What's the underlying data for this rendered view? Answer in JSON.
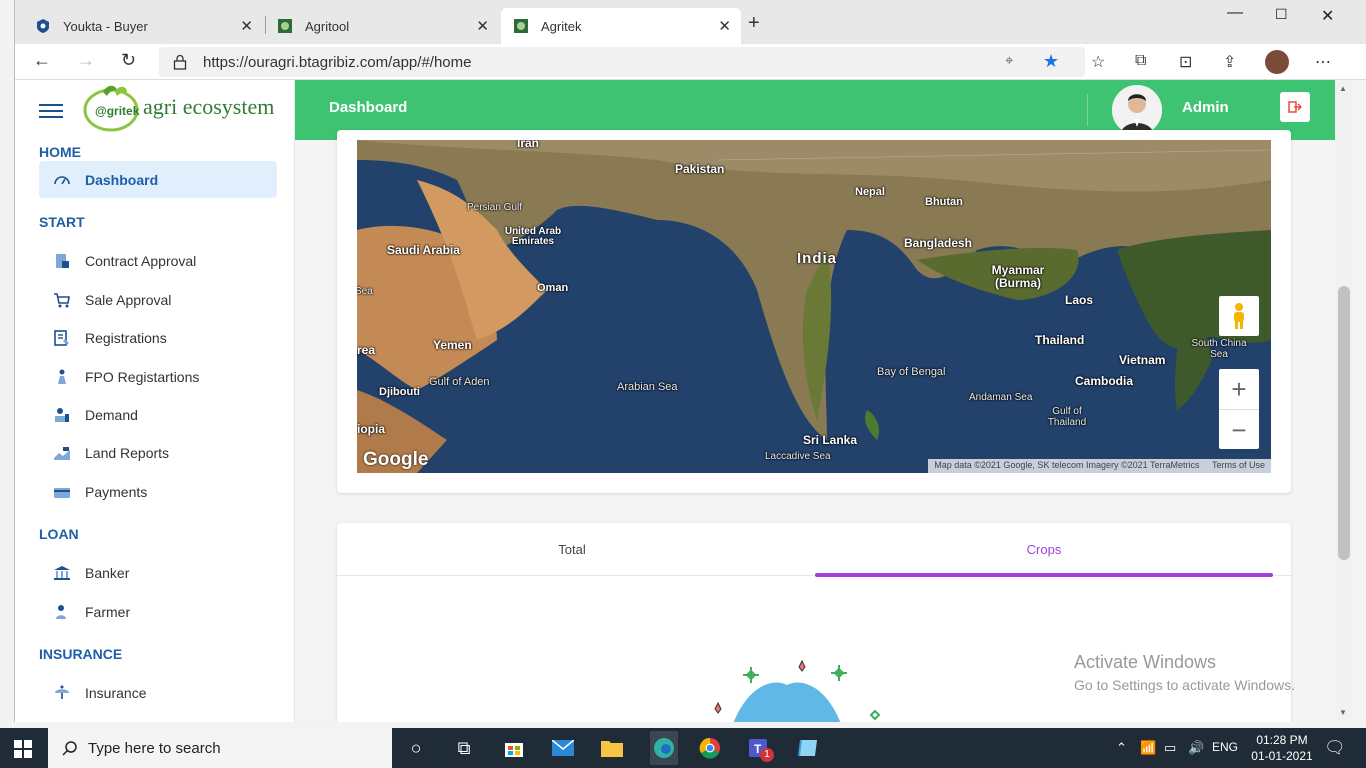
{
  "browser": {
    "tabs": [
      {
        "title": "Youkta - Buyer",
        "active": false
      },
      {
        "title": "Agritool",
        "active": false
      },
      {
        "title": "Agritek",
        "active": true
      }
    ],
    "url": "https://ouragri.btagribiz.com/app/#/home"
  },
  "sidebar": {
    "logo_text": "agri ecosystem",
    "logo_brand": "@gritek",
    "sections": [
      {
        "title": "HOME",
        "items": [
          {
            "label": "Dashboard",
            "active": true,
            "icon": "speedometer-icon"
          }
        ]
      },
      {
        "title": "START",
        "items": [
          {
            "label": "Contract Approval",
            "icon": "contract-icon"
          },
          {
            "label": "Sale Approval",
            "icon": "cart-icon"
          },
          {
            "label": "Registrations",
            "icon": "registration-icon"
          },
          {
            "label": "FPO Registartions",
            "icon": "fpo-icon"
          },
          {
            "label": "Demand",
            "icon": "demand-icon"
          },
          {
            "label": "Land Reports",
            "icon": "land-icon"
          },
          {
            "label": "Payments",
            "icon": "payment-icon"
          }
        ]
      },
      {
        "title": "LOAN",
        "items": [
          {
            "label": "Banker",
            "icon": "bank-icon"
          },
          {
            "label": "Farmer",
            "icon": "farmer-icon"
          }
        ]
      },
      {
        "title": "INSURANCE",
        "items": [
          {
            "label": "Insurance",
            "icon": "insurance-icon"
          }
        ]
      }
    ]
  },
  "header": {
    "title": "Dashboard",
    "user": "Admin"
  },
  "map": {
    "labels": {
      "iran": "Iran",
      "pakistan": "Pakistan",
      "nepal": "Nepal",
      "bhutan": "Bhutan",
      "persian_gulf": "Persian Gulf",
      "uae": "United Arab Emirates",
      "saudi": "Saudi Arabia",
      "india": "India",
      "bangladesh": "Bangladesh",
      "myanmar": "Myanmar (Burma)",
      "laos": "Laos",
      "oman": "Oman",
      "sea": "Sea",
      "south_china_sea": "South China Sea",
      "thailand": "Thailand",
      "yemen": "Yemen",
      "vietnam": "Vietnam",
      "rea": "rea",
      "gulf_of_aden": "Gulf of Aden",
      "arabian_sea": "Arabian Sea",
      "bay_of_bengal": "Bay of Bengal",
      "djibouti": "Djibouti",
      "cambodia": "Cambodia",
      "andaman_sea": "Andaman Sea",
      "gulf_of_thailand": "Gulf of Thailand",
      "iopia": "iopia",
      "sri_lanka": "Sri Lanka",
      "laccadive_sea": "Laccadive Sea"
    },
    "google_logo": "Google",
    "attribution": "Map data ©2021 Google, SK telecom Imagery ©2021 TerraMetrics",
    "terms": "Terms of Use"
  },
  "tabs_card": {
    "tabs": [
      {
        "label": "Total",
        "active": false
      },
      {
        "label": "Crops",
        "active": true
      }
    ]
  },
  "watermark": {
    "line1": "Activate Windows",
    "line2": "Go to Settings to activate Windows."
  },
  "taskbar": {
    "search_placeholder": "Type here to search",
    "language": "ENG",
    "time": "01:28 PM",
    "date": "01-01-2021",
    "teams_badge": "1"
  },
  "colors": {
    "header_green": "#3ec373",
    "sidebar_blue": "#1d5fa8",
    "tab_indicator": "#a33ee0"
  }
}
